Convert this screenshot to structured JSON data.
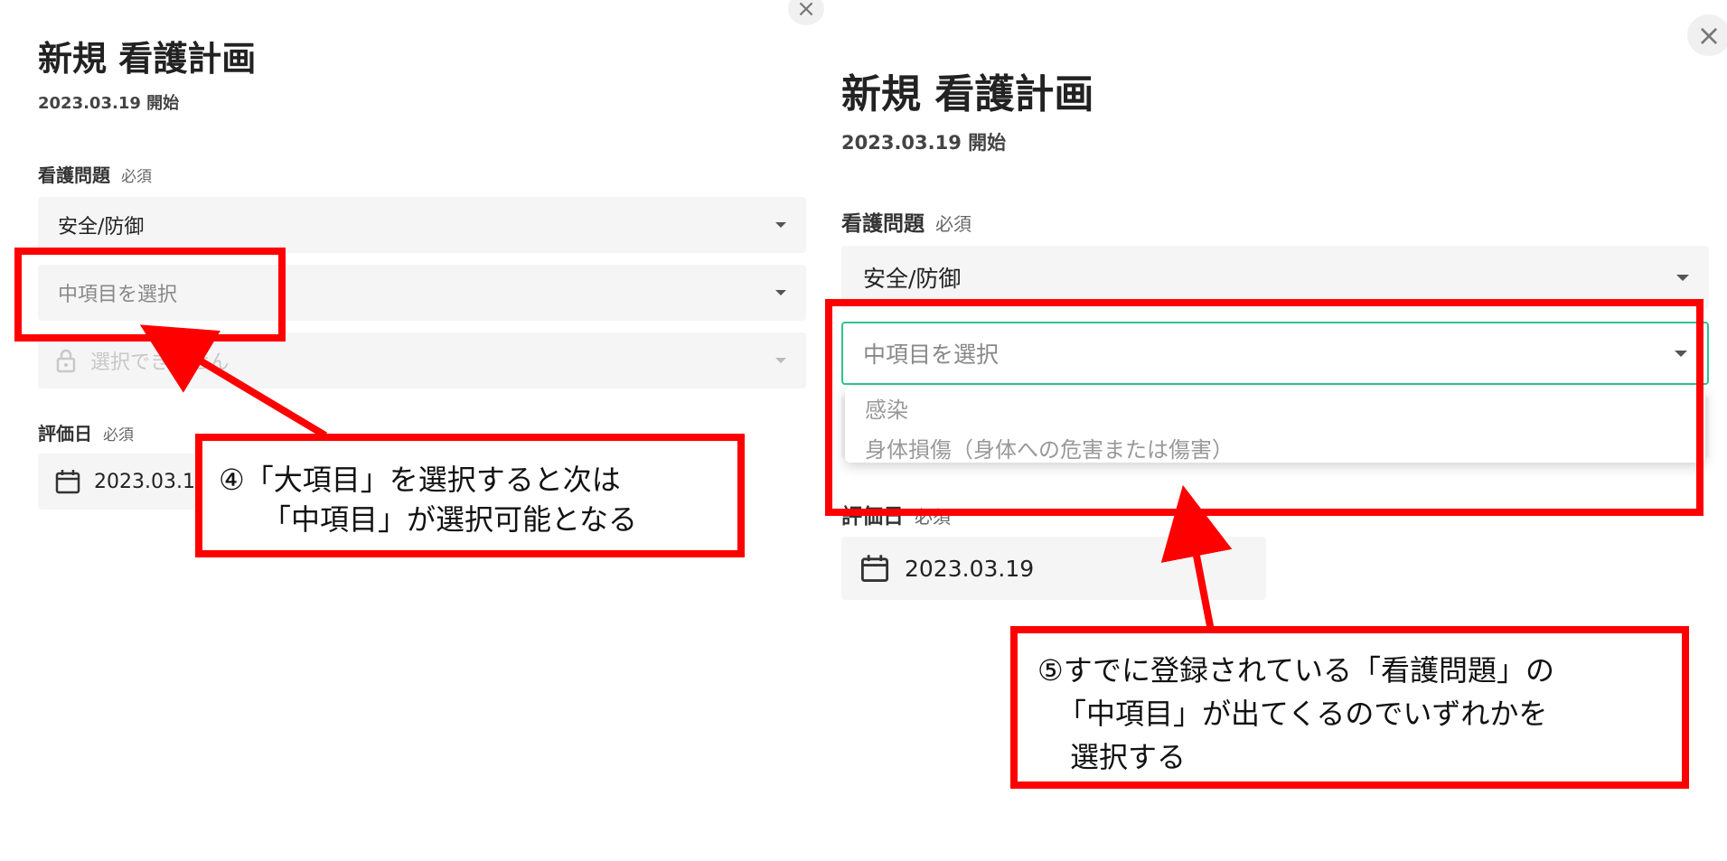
{
  "left_panel": {
    "close_icon": "×",
    "title": "新規 看護計画",
    "start_date": "2023.03.19 開始",
    "problem_label": "看護問題",
    "required": "必須",
    "major_select": "安全/防御",
    "middle_placeholder": "中項目を選択",
    "minor_disabled": "選択できません",
    "eval_label": "評価日",
    "eval_date": "2023.03.19"
  },
  "right_panel": {
    "close_icon": "×",
    "title": "新規 看護計画",
    "start_date": "2023.03.19 開始",
    "problem_label": "看護問題",
    "required": "必須",
    "major_select": "安全/防御",
    "middle_placeholder": "中項目を選択",
    "dropdown_options": [
      "感染",
      "身体損傷（身体への危害または傷害）"
    ],
    "eval_label": "評価日",
    "eval_date": "2023.03.19"
  },
  "annotations": {
    "callout4": [
      "④「大項目」を選択すると次は",
      "「中項目」が選択可能となる"
    ],
    "callout5": [
      "⑤すでに登録されている「看護問題」の",
      "「中項目」が出てくるのでいずれかを",
      "選択する"
    ]
  },
  "colors": {
    "annotation_red": "#ff0000",
    "focus_green": "#2fc48d",
    "field_bg": "#f5f5f5"
  },
  "icons": {
    "close": "close-icon",
    "dropdown": "chevron-down-icon",
    "lock": "lock-icon",
    "calendar": "calendar-icon"
  }
}
